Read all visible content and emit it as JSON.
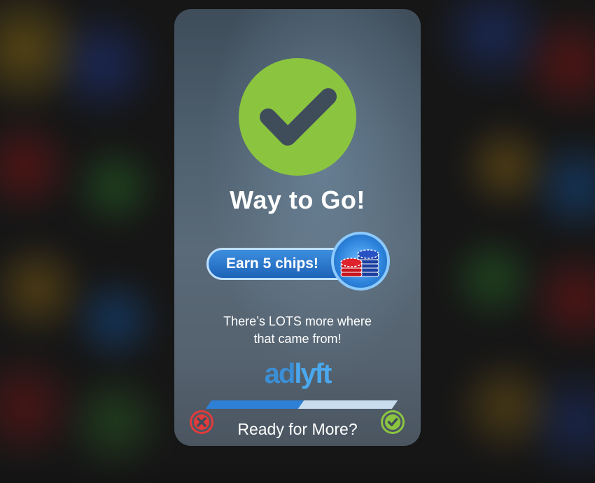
{
  "dialog": {
    "title": "Way to Go!",
    "reward_label": "Earn 5 chips!",
    "message_line1": "There’s LOTS more where",
    "message_line2": "that came from!",
    "brand_part1": "ad",
    "brand_part2": "lyft",
    "progress": {
      "completed": 3,
      "total": 6
    },
    "footer_prompt": "Ready for More?"
  },
  "icons": {
    "success": "checkmark-icon",
    "reward": "poker-chips-icon",
    "decline": "close-icon",
    "accept": "checkmark-icon"
  },
  "colors": {
    "accent_green": "#8bc540",
    "accent_blue": "#2c82da",
    "decline_red": "#e23b3b",
    "progress_filled": "#2e7fd6",
    "progress_empty": "#c7dcec"
  }
}
